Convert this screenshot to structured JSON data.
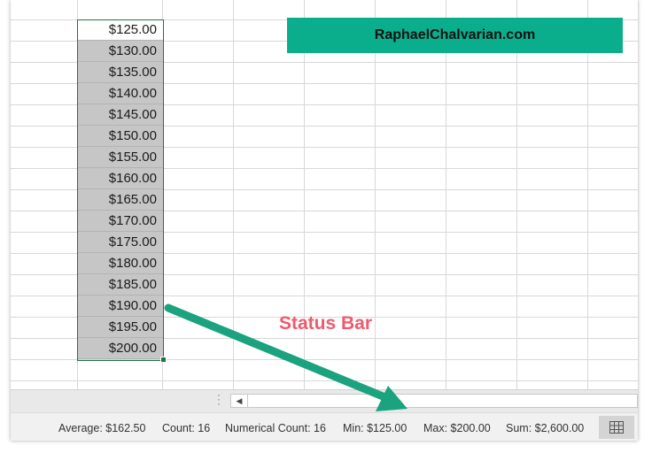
{
  "sheet": {
    "values": [
      "$125.00",
      "$130.00",
      "$135.00",
      "$140.00",
      "$145.00",
      "$150.00",
      "$155.00",
      "$160.00",
      "$165.00",
      "$170.00",
      "$175.00",
      "$180.00",
      "$185.00",
      "$190.00",
      "$195.00",
      "$200.00"
    ]
  },
  "banner": {
    "text": "RaphaelChalvarian.com",
    "color": "#0bae8c"
  },
  "annotation": {
    "text": "Status Bar",
    "color": "#f05a6e"
  },
  "statusbar": {
    "average": "Average: $162.50",
    "count": "Count: 16",
    "numerical_count": "Numerical Count: 16",
    "min": "Min: $125.00",
    "max": "Max: $200.00",
    "sum": "Sum: $2,600.00"
  },
  "icons": {
    "scroll_left": "scroll-left-icon",
    "normal_view": "normal-view-icon",
    "sheet_tab_split": "sheet-tab-split-icon"
  },
  "colors": {
    "selection": "#217346",
    "selected_fill": "#c6c6c6",
    "arrow": "#1aa37e"
  }
}
